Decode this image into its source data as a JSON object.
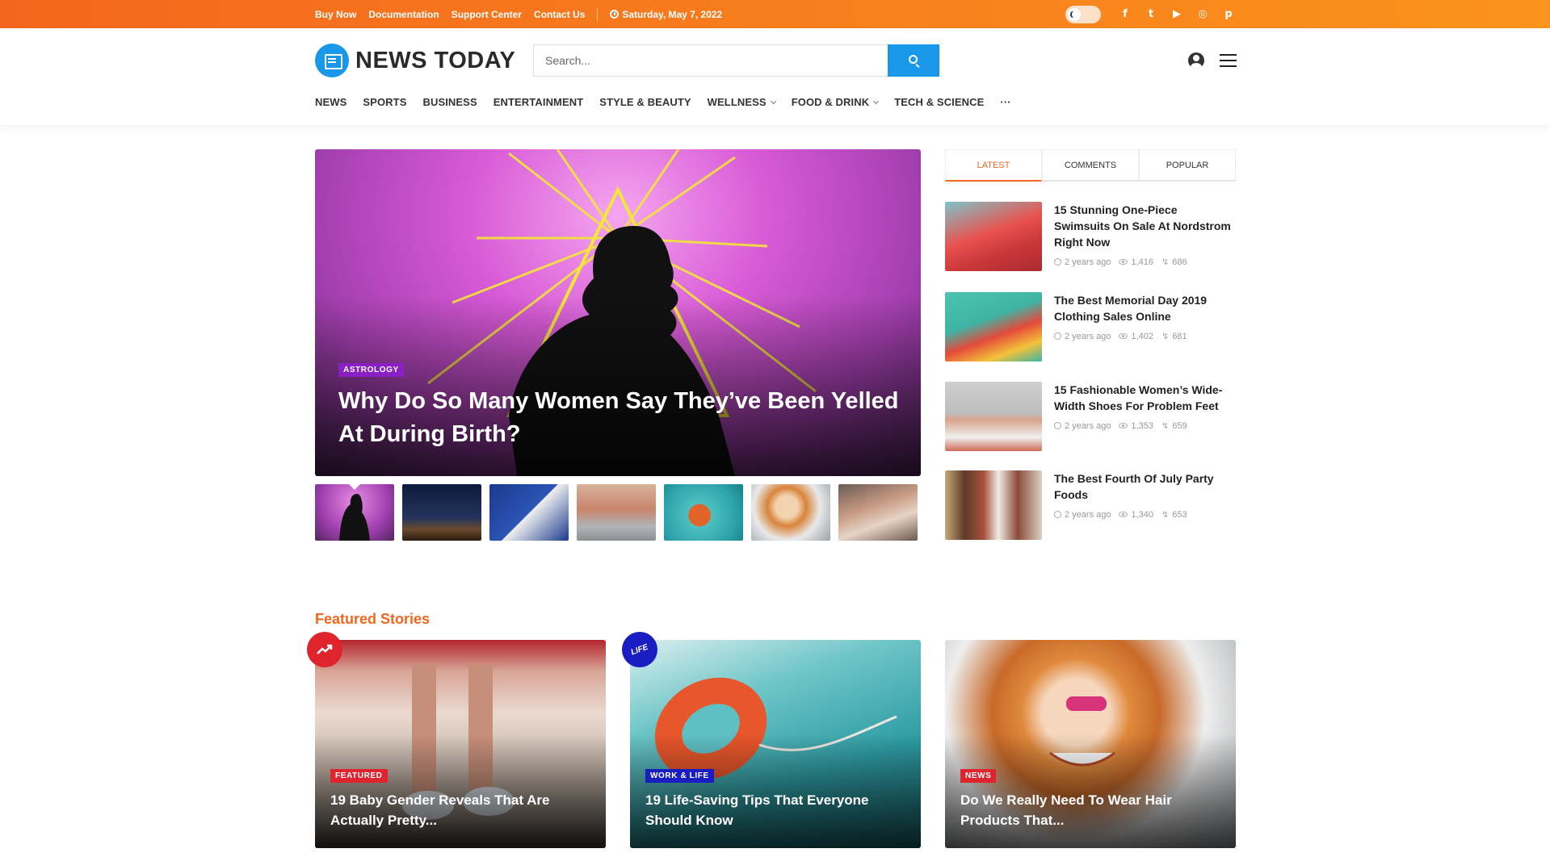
{
  "topbar": {
    "links": [
      "Buy Now",
      "Documentation",
      "Support Center",
      "Contact Us"
    ],
    "date": "Saturday, May 7, 2022",
    "social": [
      {
        "name": "facebook-icon",
        "glyph": "f"
      },
      {
        "name": "twitter-icon",
        "glyph": "t"
      },
      {
        "name": "youtube-icon",
        "glyph": "▶"
      },
      {
        "name": "instagram-icon",
        "glyph": "◎"
      },
      {
        "name": "pinterest-icon",
        "glyph": "p"
      }
    ]
  },
  "header": {
    "logo_text": "NEWS TODAY",
    "search_placeholder": "Search...",
    "nav": [
      {
        "label": "News",
        "caret": false
      },
      {
        "label": "Sports",
        "caret": false
      },
      {
        "label": "Business",
        "caret": false
      },
      {
        "label": "Entertainment",
        "caret": false
      },
      {
        "label": "Style & Beauty",
        "caret": false
      },
      {
        "label": "Wellness",
        "caret": true
      },
      {
        "label": "Food & Drink",
        "caret": true
      },
      {
        "label": "Tech & Science",
        "caret": false
      },
      {
        "label": "···",
        "caret": false
      }
    ]
  },
  "hero": {
    "category": "ASTROLOGY",
    "title": "Why Do So Many Women Say They’ve Been Yelled At During Birth?"
  },
  "sidebar": {
    "tabs": [
      "Latest",
      "Comments",
      "Popular"
    ],
    "posts": [
      {
        "title": "15 Stunning One-Piece Swimsuits On Sale At Nordstrom Right Now",
        "time": "2 years ago",
        "views": "1,416",
        "shares": "686"
      },
      {
        "title": "The Best Memorial Day 2019 Clothing Sales Online",
        "time": "2 years ago",
        "views": "1,402",
        "shares": "681"
      },
      {
        "title": "15 Fashionable Women’s Wide-Width Shoes For Problem Feet",
        "time": "2 years ago",
        "views": "1,353",
        "shares": "659"
      },
      {
        "title": "The Best Fourth Of July Party Foods",
        "time": "2 years ago",
        "views": "1,340",
        "shares": "653"
      }
    ]
  },
  "featured": {
    "title": "Featured Stories",
    "cards": [
      {
        "category": "FEATURED",
        "title": "19 Baby Gender Reveals That Are Actually Pretty...",
        "badge_color": "#e0242e",
        "icon_text": "",
        "icon_color": "#e0242e"
      },
      {
        "category": "WORK & LIFE",
        "title": "19 Life-Saving Tips That Everyone Should Know",
        "badge_color": "#1a1ec2",
        "icon_text": "LIFE",
        "icon_color": "#1a1ec2"
      },
      {
        "category": "NEWS",
        "title": "Do We Really Need To Wear Hair Products That...",
        "badge_color": "#e0242e",
        "icon_text": "",
        "icon_color": ""
      }
    ]
  },
  "colors": {
    "accent": "#f4661d",
    "brand_blue": "#1998ea"
  }
}
